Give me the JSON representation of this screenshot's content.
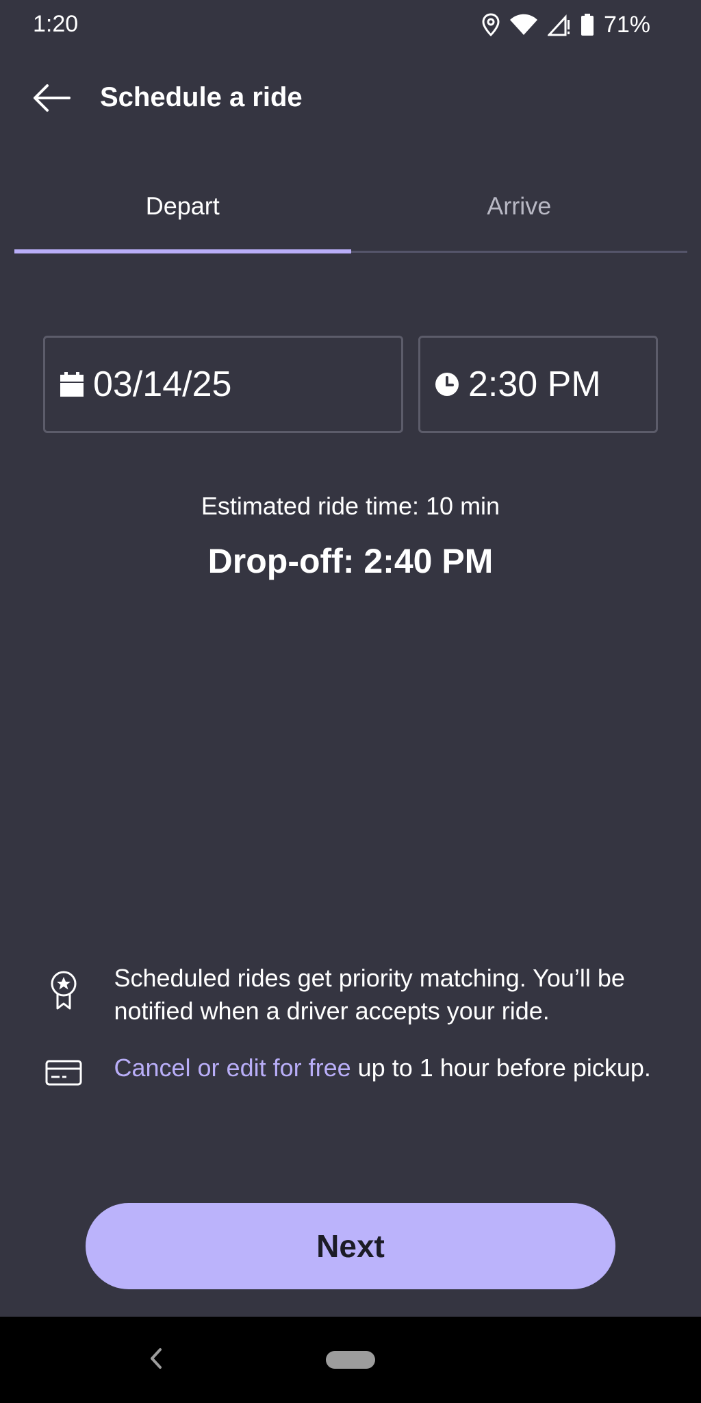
{
  "status_bar": {
    "time": "1:20",
    "battery": "71%",
    "icons": [
      "location-icon",
      "wifi-icon",
      "signal-icon",
      "battery-icon"
    ]
  },
  "header": {
    "title": "Schedule a ride",
    "back_icon": "arrow-left-icon"
  },
  "tabs": [
    {
      "label": "Depart",
      "active": true
    },
    {
      "label": "Arrive",
      "active": false
    }
  ],
  "date_field": {
    "value": "03/14/25",
    "icon": "calendar-icon"
  },
  "time_field": {
    "value": "2:30 PM",
    "icon": "clock-icon"
  },
  "estimate": {
    "ride_time": "Estimated ride time: 10 min",
    "dropoff": "Drop-off: 2:40 PM"
  },
  "info": {
    "priority_text": "Scheduled rides get priority matching. You’ll be notified when a driver accepts your ride.",
    "cancel_link": "Cancel or edit for free",
    "cancel_rest": " up to 1 hour before pickup.",
    "priority_icon": "award-badge-icon",
    "cancel_icon": "credit-card-icon"
  },
  "next_button": {
    "label": "Next"
  },
  "colors": {
    "background": "#353541",
    "accent": "#b9aef8",
    "button": "#bbb3fb"
  }
}
